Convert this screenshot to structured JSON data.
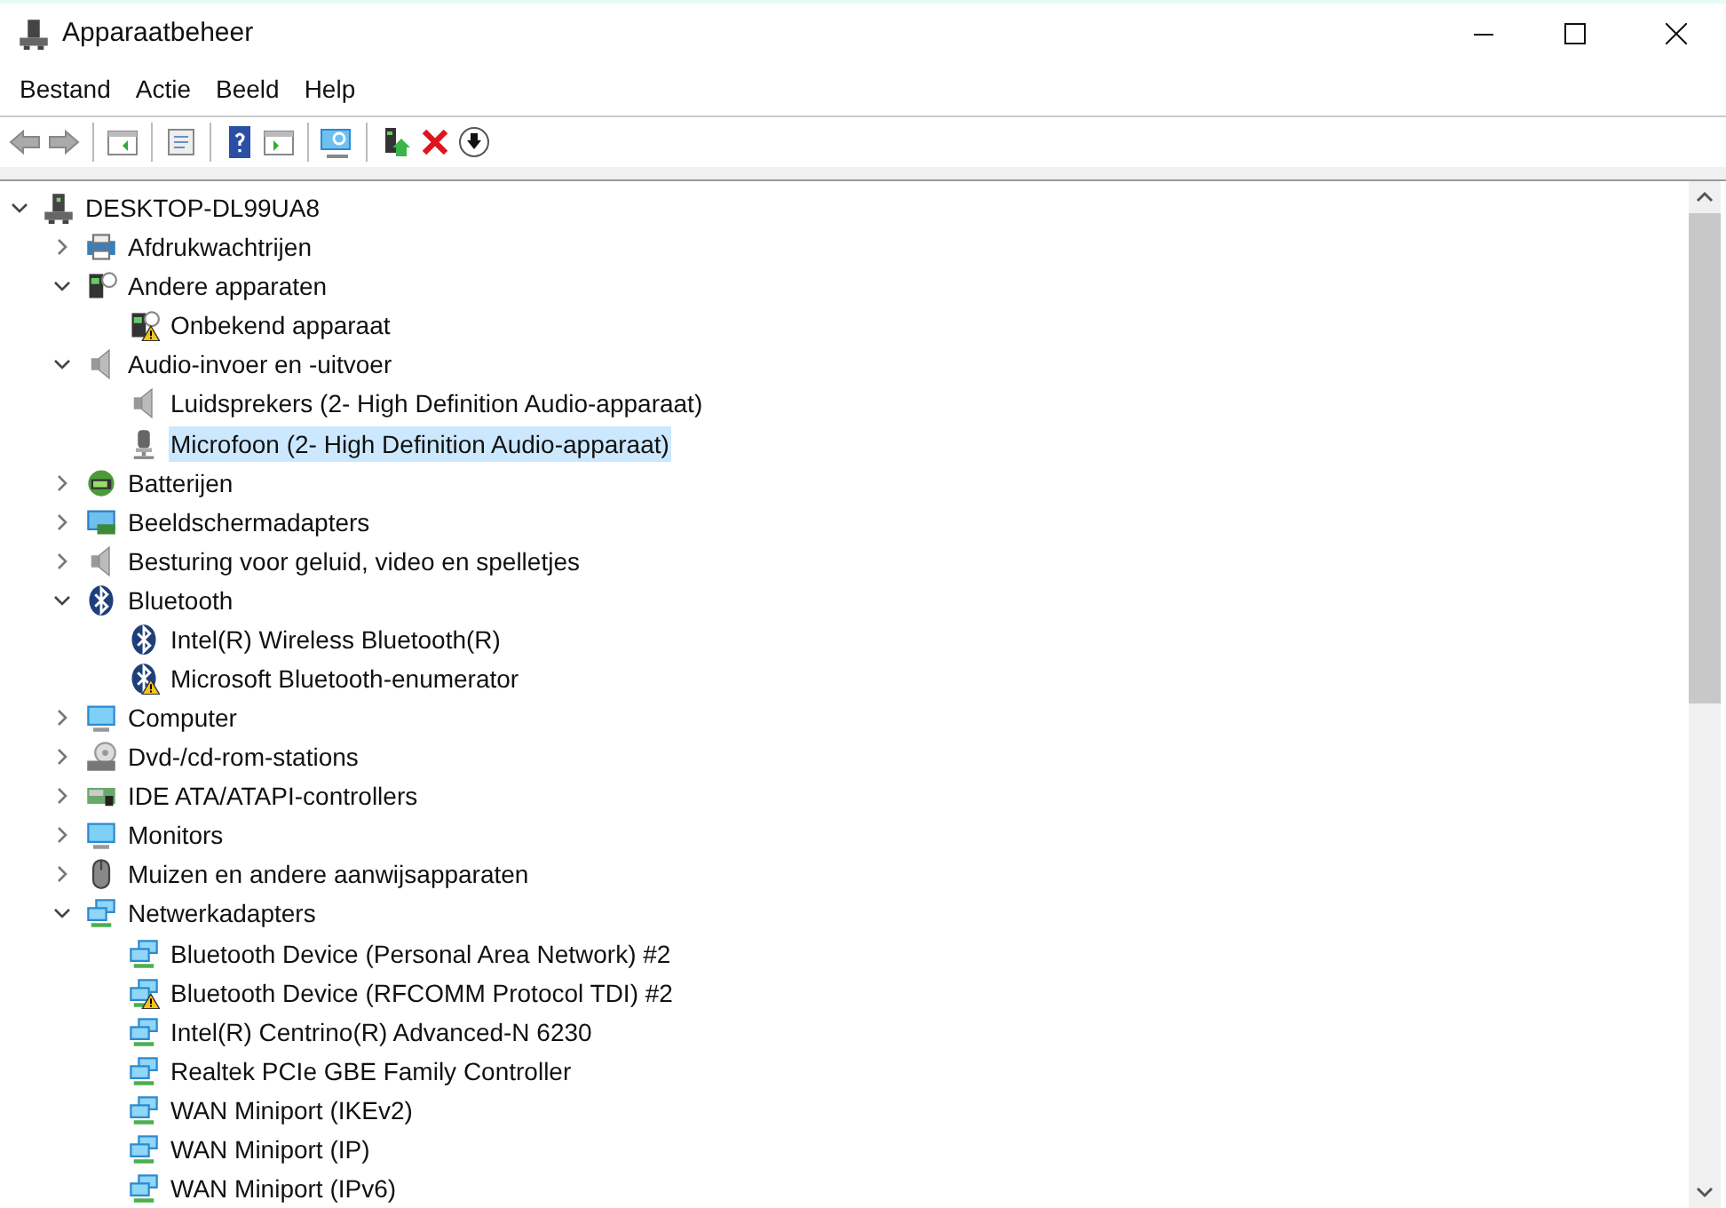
{
  "window": {
    "title": "Apparaatbeheer"
  },
  "menu": [
    "Bestand",
    "Actie",
    "Beeld",
    "Help"
  ],
  "tree": {
    "label": "DESKTOP-DL99UA8",
    "kind": "computer",
    "expanded": true,
    "selected": false,
    "warning": false,
    "children": [
      {
        "label": "Afdrukwachtrijen",
        "kind": "printer",
        "expanded": false,
        "selected": false,
        "warning": false
      },
      {
        "label": "Andere apparaten",
        "kind": "unknown",
        "expanded": true,
        "selected": false,
        "warning": false,
        "children": [
          {
            "label": "Onbekend apparaat",
            "kind": "unknown",
            "warning": true,
            "selected": false
          }
        ]
      },
      {
        "label": "Audio-invoer en -uitvoer",
        "kind": "speaker",
        "expanded": true,
        "selected": false,
        "warning": false,
        "children": [
          {
            "label": "Luidsprekers (2- High Definition Audio-apparaat)",
            "kind": "speaker",
            "selected": false,
            "warning": false
          },
          {
            "label": "Microfoon (2- High Definition Audio-apparaat)",
            "kind": "microphone",
            "selected": true,
            "warning": false
          }
        ]
      },
      {
        "label": "Batterijen",
        "kind": "battery",
        "expanded": false,
        "selected": false,
        "warning": false
      },
      {
        "label": "Beeldschermadapters",
        "kind": "display",
        "expanded": false,
        "selected": false,
        "warning": false
      },
      {
        "label": "Besturing voor geluid, video en spelletjes",
        "kind": "speaker",
        "expanded": false,
        "selected": false,
        "warning": false
      },
      {
        "label": "Bluetooth",
        "kind": "bluetooth",
        "expanded": true,
        "selected": false,
        "warning": false,
        "children": [
          {
            "label": "Intel(R) Wireless Bluetooth(R)",
            "kind": "bluetooth",
            "selected": false,
            "warning": false
          },
          {
            "label": "Microsoft Bluetooth-enumerator",
            "kind": "bluetooth",
            "warning": true,
            "selected": false
          }
        ]
      },
      {
        "label": "Computer",
        "kind": "monitor",
        "expanded": false,
        "selected": false,
        "warning": false
      },
      {
        "label": "Dvd-/cd-rom-stations",
        "kind": "dvd",
        "expanded": false,
        "selected": false,
        "warning": false
      },
      {
        "label": "IDE ATA/ATAPI-controllers",
        "kind": "ide",
        "expanded": false,
        "selected": false,
        "warning": false
      },
      {
        "label": "Monitors",
        "kind": "monitor",
        "expanded": false,
        "selected": false,
        "warning": false
      },
      {
        "label": "Muizen en andere aanwijsapparaten",
        "kind": "mouse",
        "expanded": false,
        "selected": false,
        "warning": false
      },
      {
        "label": "Netwerkadapters",
        "kind": "network",
        "expanded": true,
        "selected": false,
        "warning": false,
        "children": [
          {
            "label": "Bluetooth Device (Personal Area Network) #2",
            "kind": "network",
            "selected": false,
            "warning": false
          },
          {
            "label": "Bluetooth Device (RFCOMM Protocol TDI) #2",
            "kind": "network",
            "warning": true,
            "selected": false
          },
          {
            "label": "Intel(R) Centrino(R) Advanced-N 6230",
            "kind": "network",
            "selected": false,
            "warning": false
          },
          {
            "label": "Realtek PCIe GBE Family Controller",
            "kind": "network",
            "selected": false,
            "warning": false
          },
          {
            "label": "WAN Miniport (IKEv2)",
            "kind": "network",
            "selected": false,
            "warning": false
          },
          {
            "label": "WAN Miniport (IP)",
            "kind": "network",
            "selected": false,
            "warning": false
          },
          {
            "label": "WAN Miniport (IPv6)",
            "kind": "network",
            "selected": false,
            "warning": false
          }
        ]
      }
    ]
  }
}
